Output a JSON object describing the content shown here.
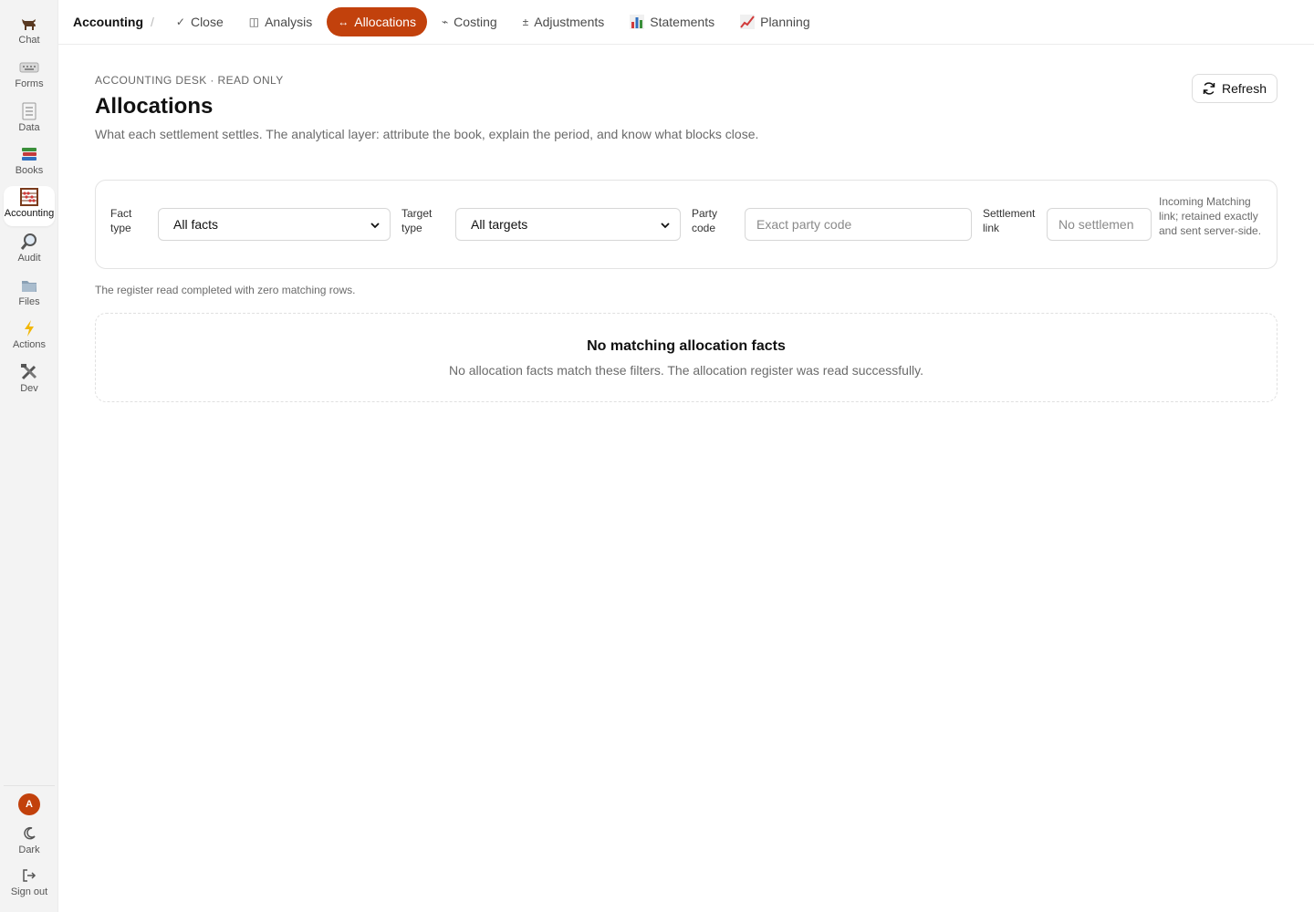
{
  "sidebar": {
    "items": [
      {
        "label": "Chat",
        "icon": "ox-icon"
      },
      {
        "label": "Forms",
        "icon": "keyboard-icon"
      },
      {
        "label": "Data",
        "icon": "spreadsheet-icon"
      },
      {
        "label": "Books",
        "icon": "books-icon"
      },
      {
        "label": "Accounting",
        "icon": "abacus-icon"
      },
      {
        "label": "Audit",
        "icon": "magnifier-icon"
      },
      {
        "label": "Files",
        "icon": "folder-icon"
      },
      {
        "label": "Actions",
        "icon": "lightning-icon"
      },
      {
        "label": "Dev",
        "icon": "tools-icon"
      }
    ],
    "active": "Accounting",
    "avatar_initial": "A",
    "theme_label": "Dark",
    "signout_label": "Sign out"
  },
  "topnav": {
    "breadcrumb": "Accounting",
    "separator": "/",
    "tabs": [
      {
        "label": "Close",
        "icon": "check-icon",
        "glyph": "✓"
      },
      {
        "label": "Analysis",
        "icon": "split-panel-icon",
        "glyph": "◫"
      },
      {
        "label": "Allocations",
        "icon": "arrows-left-right-icon",
        "glyph": "↔"
      },
      {
        "label": "Costing",
        "icon": "tilde-arrow-icon",
        "glyph": "⌁"
      },
      {
        "label": "Adjustments",
        "icon": "plus-minus-icon",
        "glyph": "±"
      },
      {
        "label": "Statements",
        "icon": "bar-chart-icon",
        "glyph": ""
      },
      {
        "label": "Planning",
        "icon": "trend-chart-icon",
        "glyph": ""
      }
    ],
    "active_tab": "Allocations"
  },
  "page": {
    "eyebrow": "ACCOUNTING DESK · READ ONLY",
    "title": "Allocations",
    "description": "What each settlement settles. The analytical layer: attribute the book, explain the period, and know what blocks close.",
    "refresh_label": "Refresh"
  },
  "filters": {
    "fact_type": {
      "label": "Fact type",
      "value": "All facts"
    },
    "target_type": {
      "label": "Target type",
      "value": "All targets"
    },
    "party_code": {
      "label": "Party code",
      "placeholder": "Exact party code"
    },
    "settlement_link": {
      "label": "Settlement link",
      "placeholder": "No settlemen"
    },
    "hint": "Incoming Matching link; retained exactly and sent server-side."
  },
  "status": "The register read completed with zero matching rows.",
  "empty_state": {
    "title": "No matching allocation facts",
    "description": "No allocation facts match these filters. The allocation register was read successfully."
  },
  "colors": {
    "accent": "#c2410c",
    "sidebar_bg": "#f3f3f3",
    "border": "#e3e3e3",
    "muted_text": "#6b6b6b"
  }
}
